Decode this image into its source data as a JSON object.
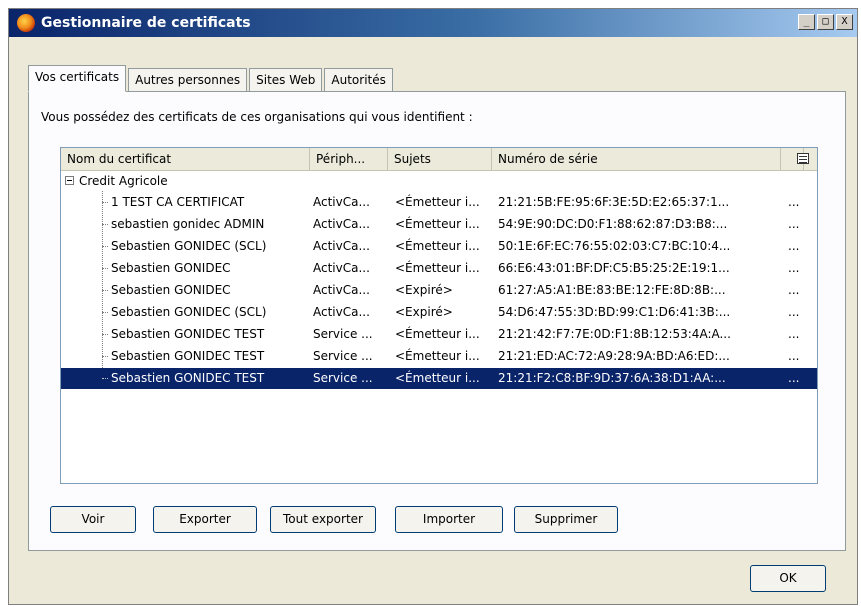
{
  "window": {
    "title": "Gestionnaire de certificats",
    "controls": {
      "minimize": "_",
      "maximize": "□",
      "close": "X"
    }
  },
  "tabs": [
    {
      "label": "Vos certificats",
      "active": true
    },
    {
      "label": "Autres personnes",
      "active": false
    },
    {
      "label": "Sites Web",
      "active": false
    },
    {
      "label": "Autorités",
      "active": false
    }
  ],
  "panel": {
    "intro": "Vous possédez des certificats de ces organisations qui vous identifient :"
  },
  "table": {
    "columns": [
      "Nom du certificat",
      "Périph...",
      "Sujets",
      "Numéro de série"
    ],
    "group": "Credit Agricole",
    "rows": [
      {
        "name": "1 TEST CA CERTIFICAT",
        "device": "ActivCa...",
        "subject": "<Émetteur i...",
        "serial": "21:21:5B:FE:95:6F:3E:5D:E2:65:37:1...",
        "extra": "...",
        "selected": false
      },
      {
        "name": "sebastien gonidec ADMIN",
        "device": "ActivCa...",
        "subject": "<Émetteur i...",
        "serial": "54:9E:90:DC:D0:F1:88:62:87:D3:B8:...",
        "extra": "...",
        "selected": false
      },
      {
        "name": "Sebastien GONIDEC (SCL)",
        "device": "ActivCa...",
        "subject": "<Émetteur i...",
        "serial": "50:1E:6F:EC:76:55:02:03:C7:BC:10:4...",
        "extra": "...",
        "selected": false
      },
      {
        "name": "Sebastien GONIDEC",
        "device": "ActivCa...",
        "subject": "<Émetteur i...",
        "serial": "66:E6:43:01:BF:DF:C5:B5:25:2E:19:1...",
        "extra": "...",
        "selected": false
      },
      {
        "name": "Sebastien GONIDEC",
        "device": "ActivCa...",
        "subject": "<Expiré>",
        "serial": "61:27:A5:A1:BE:83:BE:12:FE:8D:8B:...",
        "extra": "...",
        "selected": false
      },
      {
        "name": "Sebastien GONIDEC (SCL)",
        "device": "ActivCa...",
        "subject": "<Expiré>",
        "serial": "54:D6:47:55:3D:BD:99:C1:D6:41:3B:...",
        "extra": "...",
        "selected": false
      },
      {
        "name": "Sebastien GONIDEC TEST",
        "device": "Service ...",
        "subject": "<Émetteur i...",
        "serial": "21:21:42:F7:7E:0D:F1:8B:12:53:4A:A...",
        "extra": "...",
        "selected": false
      },
      {
        "name": "Sebastien GONIDEC TEST",
        "device": "Service ...",
        "subject": "<Émetteur i...",
        "serial": "21:21:ED:AC:72:A9:28:9A:BD:A6:ED:...",
        "extra": "...",
        "selected": false
      },
      {
        "name": "Sebastien GONIDEC TEST",
        "device": "Service ...",
        "subject": "<Émetteur i...",
        "serial": "21:21:F2:C8:BF:9D:37:6A:38:D1:AA:...",
        "extra": "...",
        "selected": true
      }
    ]
  },
  "buttons": {
    "view": "Voir",
    "export": "Exporter",
    "export_all": "Tout exporter",
    "import": "Importer",
    "delete": "Supprimer",
    "ok": "OK"
  },
  "colors": {
    "selection": "#0a246a",
    "dialog_bg": "#ece9d8",
    "title_bar": "#0a246a"
  }
}
